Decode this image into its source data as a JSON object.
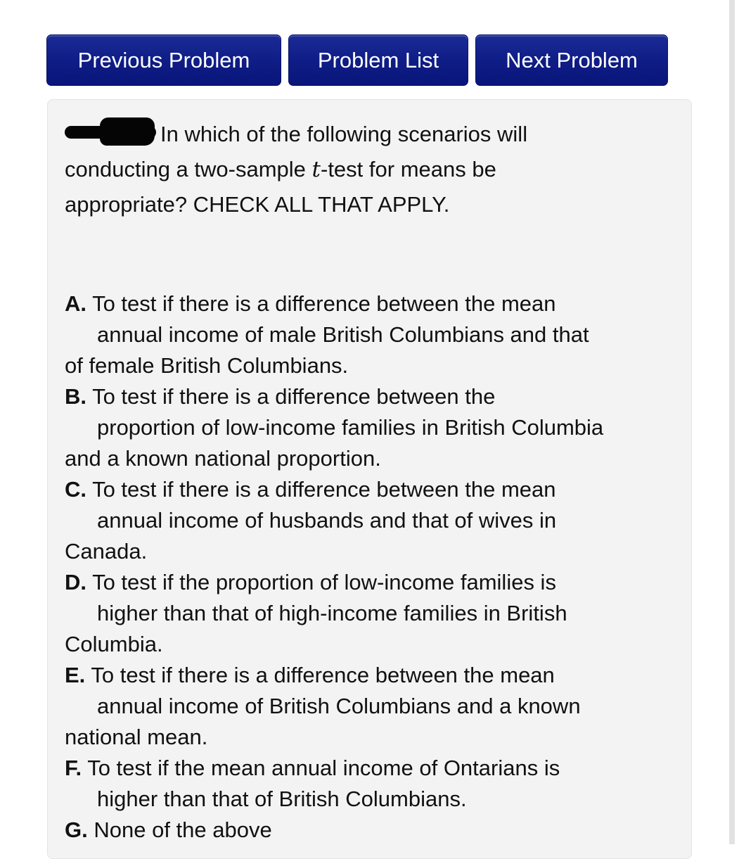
{
  "nav": {
    "previous_label": "Previous Problem",
    "list_label": "Problem List",
    "next_label": "Next Problem",
    "button_color": "#0f1d86"
  },
  "problem": {
    "question_part1": "In which of the following scenarios will",
    "question_part2_pre": "conducting a two-sample ",
    "question_math": "t",
    "question_part2_post": "-test for means be",
    "question_part3": "appropriate? CHECK ALL THAT APPLY.",
    "options": [
      {
        "letter": "A.",
        "lines": [
          "To test if there is a difference between the mean",
          "annual income of male British Columbians and that",
          "of female British Columbians."
        ],
        "checked": false
      },
      {
        "letter": "B.",
        "lines": [
          "To test if there is a difference between the",
          "proportion of low-income families in British Columbia",
          "and a known national proportion."
        ],
        "checked": false
      },
      {
        "letter": "C.",
        "lines": [
          "To test if there is a difference between the mean",
          "annual income of husbands and that of wives in",
          "Canada."
        ],
        "checked": false
      },
      {
        "letter": "D.",
        "lines": [
          "To test if the proportion of low-income families is",
          "higher than that of high-income families in British",
          "Columbia."
        ],
        "checked": false
      },
      {
        "letter": "E.",
        "lines": [
          "To test if there is a difference between the mean",
          "annual income of British Columbians and a known",
          "national mean."
        ],
        "checked": false
      },
      {
        "letter": "F.",
        "lines": [
          "To test if the mean annual income of Ontarians is",
          "higher than that of British Columbians."
        ],
        "checked": false
      },
      {
        "letter": "G.",
        "lines": [
          "None of the above"
        ],
        "checked": false
      }
    ]
  }
}
